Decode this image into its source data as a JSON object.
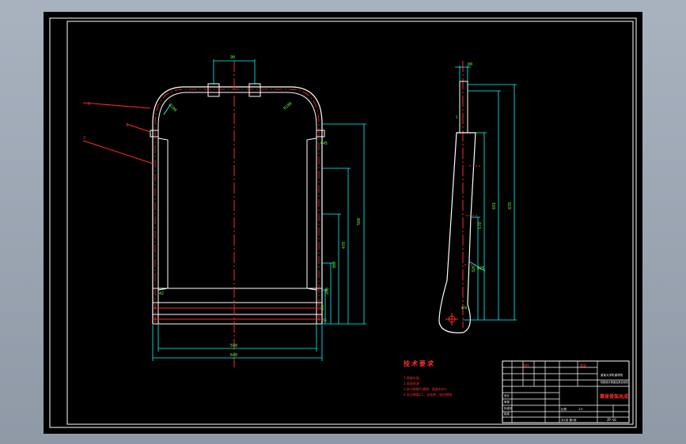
{
  "drawing": {
    "tech_req_title": "技术要求",
    "tech_req_lines": [
      "1.焊接牢固",
      "2.表面喷漆",
      "3.未注焊缝为满焊，高度4mm",
      "4.未注倒角C1，去毛刺，锐边倒钝"
    ],
    "part_labels": [
      "1",
      "2",
      "3"
    ],
    "front_dims": {
      "top_width": "90",
      "inner_width": "590",
      "outer_width": "640",
      "radius_left": "R100",
      "radius_right": "R100",
      "pipe": "Φ45",
      "heights": [
        "560",
        "478",
        "300",
        "200",
        "100",
        "50"
      ],
      "small_left": "42"
    },
    "side_dims": {
      "top": "80",
      "left_small": "5",
      "heights_outer": [
        "878",
        "691",
        "578",
        "326"
      ],
      "angle": "Φ25",
      "hole": "Φ20"
    },
    "title_block": {
      "drawing_name": "靠背骨架总成",
      "company": "某某大学机械学院",
      "class": "机械设计制造及其自动化",
      "scale_label": "比例",
      "scale": "1:5",
      "sheet": "共1张 第1张",
      "drawing_no": "ZP-01",
      "designer": "设计",
      "checker": "审核",
      "standard": "标准化",
      "approve": "批准",
      "red_marks": [
        "材料",
        "重量"
      ]
    }
  },
  "colors": {
    "background": "#000000",
    "outline": "#ffffff",
    "centerline": "#ff2a2a",
    "dimension": "#00ffff",
    "text_red": "#ff3030",
    "annotation_green": "#66ff33"
  }
}
